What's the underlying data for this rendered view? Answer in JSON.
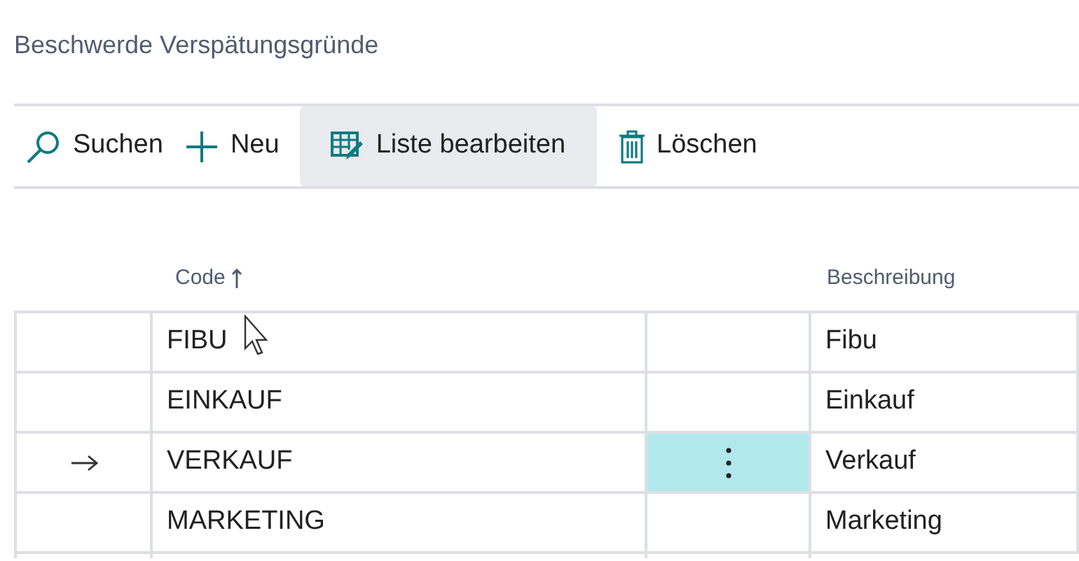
{
  "page_title": "Beschwerde Verspätungsgründe",
  "actions": [
    {
      "kind": "search",
      "label": "Suchen",
      "hovered": false
    },
    {
      "kind": "new",
      "label": "Neu",
      "hovered": false
    },
    {
      "kind": "edit_list",
      "label": "Liste bearbeiten",
      "hovered": true
    },
    {
      "kind": "delete",
      "label": "Löschen",
      "hovered": false
    }
  ],
  "table": {
    "columns": [
      {
        "label": "Code",
        "sorted": true
      },
      {
        "label": "Beschreibung",
        "sorted": false
      }
    ],
    "rows": [
      {
        "code": "FIBU",
        "description": "Fibu",
        "selected": false
      },
      {
        "code": "EINKAUF",
        "description": "Einkauf",
        "selected": false
      },
      {
        "code": "VERKAUF",
        "description": "Verkauf",
        "selected": true
      },
      {
        "code": "MARKETING",
        "description": "Marketing",
        "selected": false
      }
    ]
  }
}
